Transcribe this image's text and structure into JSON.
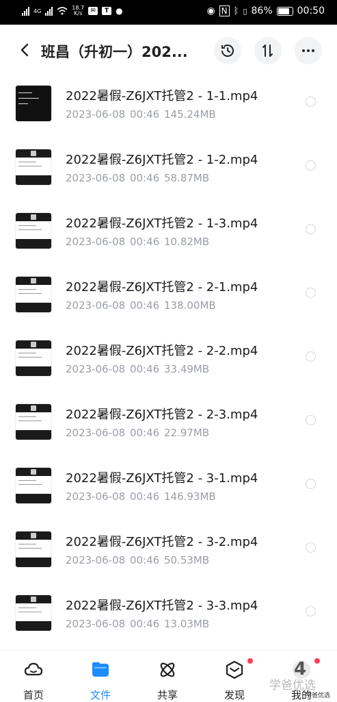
{
  "status_bar": {
    "network": "4G",
    "speed": "18.7\nK/s",
    "battery_percent": "86%",
    "time": "00:50",
    "nfc": "N"
  },
  "header": {
    "title": "班昌（升初一）202...",
    "icons": [
      "back-icon",
      "history-icon",
      "sort-icon",
      "more-icon"
    ]
  },
  "files": [
    {
      "name": "2022暑假-Z6JXT托管2 - 1-1.mp4",
      "date": "2023-06-08",
      "time": "00:46",
      "size": "145.24MB",
      "thumb": "dark"
    },
    {
      "name": "2022暑假-Z6JXT托管2 - 1-2.mp4",
      "date": "2023-06-08",
      "time": "00:46",
      "size": "58.87MB",
      "thumb": "light"
    },
    {
      "name": "2022暑假-Z6JXT托管2 - 1-3.mp4",
      "date": "2023-06-08",
      "time": "00:46",
      "size": "10.82MB",
      "thumb": "light"
    },
    {
      "name": "2022暑假-Z6JXT托管2 - 2-1.mp4",
      "date": "2023-06-08",
      "time": "00:46",
      "size": "138.00MB",
      "thumb": "light"
    },
    {
      "name": "2022暑假-Z6JXT托管2 - 2-2.mp4",
      "date": "2023-06-08",
      "time": "00:46",
      "size": "33.49MB",
      "thumb": "light"
    },
    {
      "name": "2022暑假-Z6JXT托管2 - 2-3.mp4",
      "date": "2023-06-08",
      "time": "00:46",
      "size": "22.97MB",
      "thumb": "light"
    },
    {
      "name": "2022暑假-Z6JXT托管2 - 3-1.mp4",
      "date": "2023-06-08",
      "time": "00:46",
      "size": "146.93MB",
      "thumb": "light"
    },
    {
      "name": "2022暑假-Z6JXT托管2 - 3-2.mp4",
      "date": "2023-06-08",
      "time": "00:46",
      "size": "50.53MB",
      "thumb": "light"
    },
    {
      "name": "2022暑假-Z6JXT托管2 - 3-3.mp4",
      "date": "2023-06-08",
      "time": "00:46",
      "size": "13.03MB",
      "thumb": "light"
    }
  ],
  "bottom_nav": [
    {
      "label": "首页",
      "icon": "cloud-icon",
      "active": false,
      "dot": false
    },
    {
      "label": "文件",
      "icon": "folder-icon",
      "active": true,
      "dot": false
    },
    {
      "label": "共享",
      "icon": "share-atom-icon",
      "active": false,
      "dot": false
    },
    {
      "label": "发现",
      "icon": "discover-cube-icon",
      "active": false,
      "dot": true
    },
    {
      "label": "我的",
      "icon": "avatar-icon",
      "active": false,
      "dot": true
    }
  ],
  "watermark": {
    "text": "学爸优选",
    "digit": "4",
    "small": "学爸优选"
  },
  "colors": {
    "accent": "#1e8cff",
    "badge": "#ff3d5a",
    "meta_text": "#9a9ea6"
  }
}
